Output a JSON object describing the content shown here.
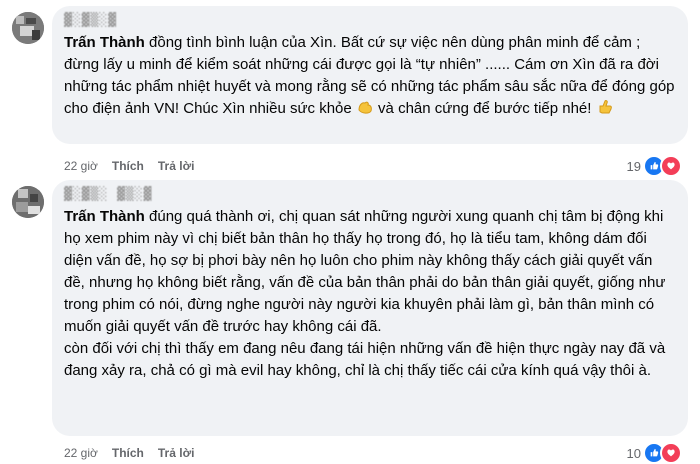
{
  "comments": [
    {
      "author_hidden": "▓░▓▒░▓",
      "mention": "Trấn Thành",
      "text": " đồng tình bình luận của Xìn. Bất cứ sự việc nên dùng phân minh để cảm ; đừng lấy u minh để kiểm soát những cái được gọi là “tự nhiên” ...... Cám ơn Xìn đã ra đời những tác phẩm nhiệt huyết và mong rằng sẽ có những tác phẩm sâu sắc nữa để đóng góp cho điện ảnh VN! Chúc Xìn nhiều sức khỏe",
      "text_tail_1": " và chân cứng để bước tiếp nhé!",
      "time": "22 giờ",
      "like_label": "Thích",
      "reply_label": "Trả lời",
      "reaction_count": "19"
    },
    {
      "author_hidden": "▓░▓▒░ ▓▒░▓",
      "mention": "Trấn Thành",
      "paragraph1": " đúng quá thành ơi, chị quan sát những người xung quanh chị tâm bị động khi họ xem phim này vì chị biết bản thân họ thấy họ trong đó, họ là tiểu tam, không dám đối diện vấn đề, họ sợ bị phơi bày nên họ luôn cho phim này không thấy cách giải quyết vấn đề, nhưng họ không biết rằng, vấn đề của bản thân phải do bản thân giải quyết, giống như trong phim có nói, đừng nghe người này người kia khuyên phải làm gì, bản thân mình có muốn giải quyết vấn đề trước hay không cái đã.",
      "paragraph2": "còn đối với chị thì thấy em đang nêu đang tái hiện những vấn đề hiện thực ngày nay đã và đang xảy ra, chả có gì mà evil hay không, chỉ là chị thấy tiếc cái cửa kính quá vậy thôi à.",
      "time": "22 giờ",
      "like_label": "Thích",
      "reply_label": "Trả lời",
      "reaction_count": "10"
    }
  ],
  "colors": {
    "bubble": "#f0f2f5",
    "like": "#1877f2",
    "heart": "#f33e58",
    "meta": "#65676b"
  },
  "icons": [
    "muscle-emoji",
    "thumbs-up-emoji",
    "like-reaction-icon",
    "heart-reaction-icon"
  ]
}
